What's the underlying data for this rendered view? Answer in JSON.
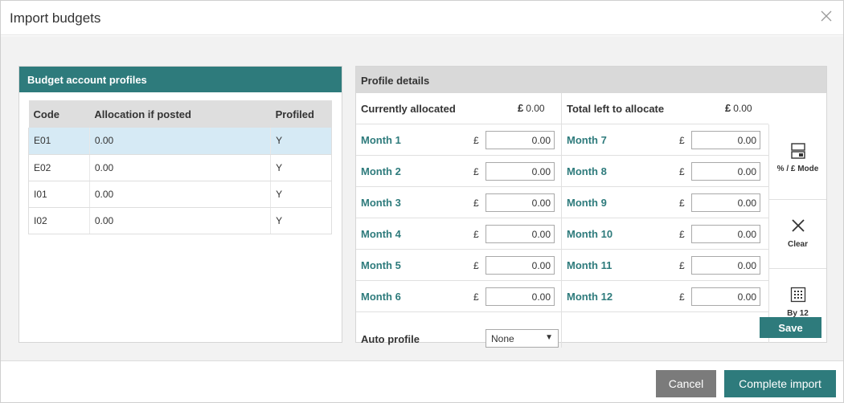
{
  "dialog": {
    "title": "Import budgets",
    "close_icon": "close-icon"
  },
  "left": {
    "title": "Budget account profiles",
    "columns": [
      "Code",
      "Allocation if posted",
      "Profiled"
    ],
    "rows": [
      {
        "code": "E01",
        "allocation": "0.00",
        "profiled": "Y"
      },
      {
        "code": "E02",
        "allocation": "0.00",
        "profiled": "Y"
      },
      {
        "code": "I01",
        "allocation": "0.00",
        "profiled": "Y"
      },
      {
        "code": "I02",
        "allocation": "0.00",
        "profiled": "Y"
      }
    ],
    "selected_color": "#d6eaf5"
  },
  "right": {
    "title": "Profile details",
    "currently_allocated_label": "Currently allocated",
    "currently_allocated_currency": "£",
    "currently_allocated_value": "0.00",
    "total_left_label": "Total left to allocate",
    "total_left_currency": "£",
    "total_left_value": "0.00",
    "currency_symbol": "£",
    "months": [
      {
        "label": "Month 1",
        "value": "0.00"
      },
      {
        "label": "Month 2",
        "value": "0.00"
      },
      {
        "label": "Month 3",
        "value": "0.00"
      },
      {
        "label": "Month 4",
        "value": "0.00"
      },
      {
        "label": "Month 5",
        "value": "0.00"
      },
      {
        "label": "Month 6",
        "value": "0.00"
      },
      {
        "label": "Month 7",
        "value": "0.00"
      },
      {
        "label": "Month 8",
        "value": "0.00"
      },
      {
        "label": "Month 9",
        "value": "0.00"
      },
      {
        "label": "Month 10",
        "value": "0.00"
      },
      {
        "label": "Month 11",
        "value": "0.00"
      },
      {
        "label": "Month 12",
        "value": "0.00"
      }
    ],
    "tools": {
      "mode_label": "% / £ Mode",
      "clear_label": "Clear",
      "by12_label": "By 12"
    },
    "auto_profile_label": "Auto profile",
    "auto_profile_value": "None",
    "save_label": "Save"
  },
  "footer": {
    "cancel_label": "Cancel",
    "complete_label": "Complete import"
  },
  "colors": {
    "accent": "#2e7b7c",
    "cancel": "#7b7b7b"
  }
}
